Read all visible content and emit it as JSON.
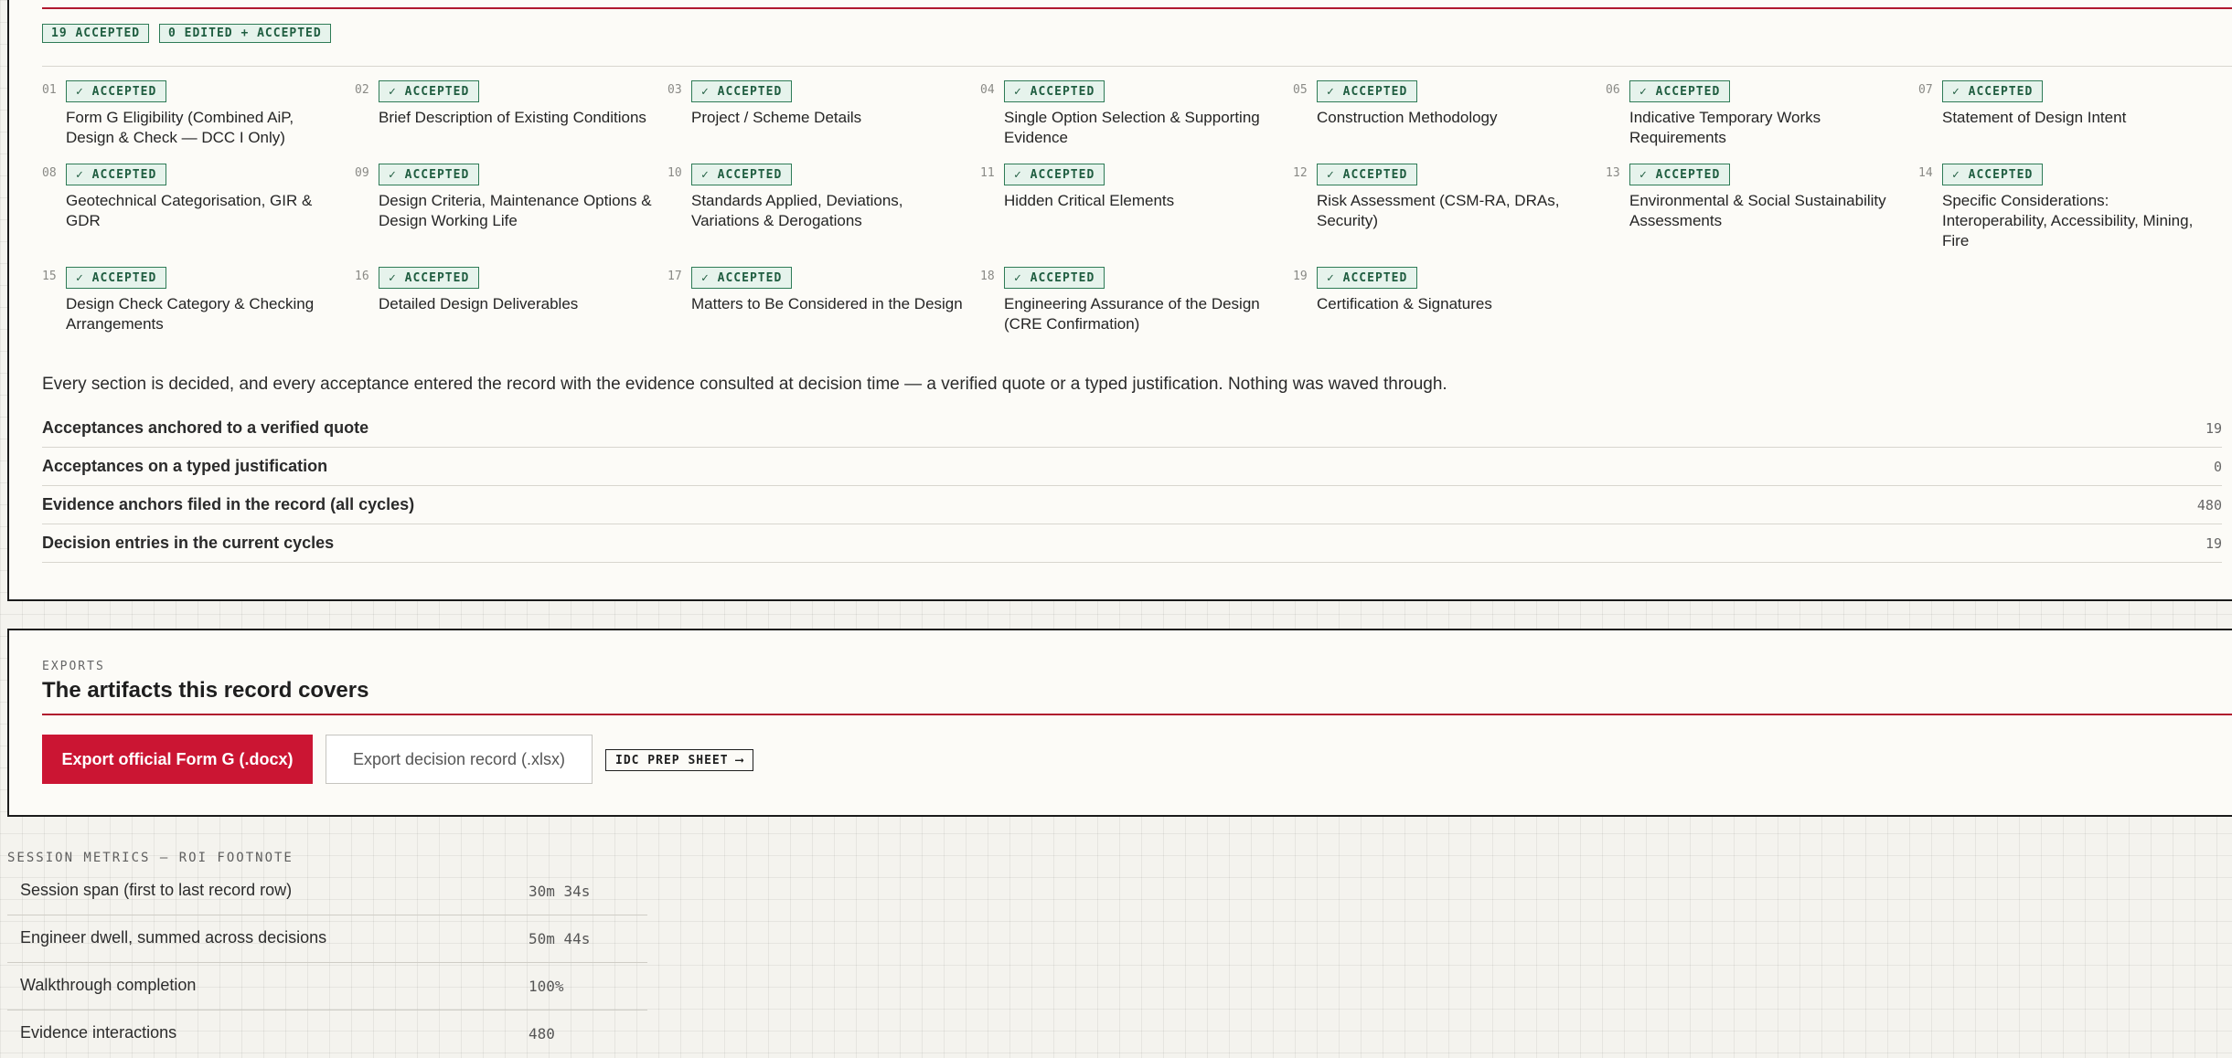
{
  "decisions": {
    "badges": [
      "19 ACCEPTED",
      "0 EDITED + ACCEPTED"
    ],
    "status_label": "✓ ACCEPTED",
    "sections": [
      {
        "num": "01",
        "title": "Form G Eligibility (Combined AiP, Design & Check — DCC I Only)"
      },
      {
        "num": "02",
        "title": "Brief Description of Existing Conditions"
      },
      {
        "num": "03",
        "title": "Project / Scheme Details"
      },
      {
        "num": "04",
        "title": "Single Option Selection & Supporting Evidence"
      },
      {
        "num": "05",
        "title": "Construction Methodology"
      },
      {
        "num": "06",
        "title": "Indicative Temporary Works Requirements"
      },
      {
        "num": "07",
        "title": "Statement of Design Intent"
      },
      {
        "num": "08",
        "title": "Geotechnical Categorisation, GIR & GDR"
      },
      {
        "num": "09",
        "title": "Design Criteria, Maintenance Options & Design Working Life"
      },
      {
        "num": "10",
        "title": "Standards Applied, Deviations, Variations & Derogations"
      },
      {
        "num": "11",
        "title": "Hidden Critical Elements"
      },
      {
        "num": "12",
        "title": "Risk Assessment (CSM-RA, DRAs, Security)"
      },
      {
        "num": "13",
        "title": "Environmental & Social Sustainability Assessments"
      },
      {
        "num": "14",
        "title": "Specific Considerations: Interoperability, Accessibility, Mining, Fire"
      },
      {
        "num": "15",
        "title": "Design Check Category & Checking Arrangements"
      },
      {
        "num": "16",
        "title": "Detailed Design Deliverables"
      },
      {
        "num": "17",
        "title": "Matters to Be Considered in the Design"
      },
      {
        "num": "18",
        "title": "Engineering Assurance of the Design (CRE Confirmation)"
      },
      {
        "num": "19",
        "title": "Certification & Signatures"
      }
    ],
    "summary": "Every section is decided, and every acceptance entered the record with the evidence consulted at decision time — a verified quote or a typed justification. Nothing was waved through.",
    "metrics": [
      {
        "label": "Acceptances anchored to a verified quote",
        "value": "19"
      },
      {
        "label": "Acceptances on a typed justification",
        "value": "0"
      },
      {
        "label": "Evidence anchors filed in the record (all cycles)",
        "value": "480"
      },
      {
        "label": "Decision entries in the current cycles",
        "value": "19"
      }
    ]
  },
  "exports": {
    "eyebrow": "EXPORTS",
    "title": "The artifacts this record covers",
    "primary_button": "Export official Form G (.docx)",
    "secondary_button": "Export decision record (.xlsx)",
    "link_button": "IDC PREP SHEET",
    "link_arrow": "⟶"
  },
  "roi": {
    "eyebrow": "SESSION METRICS — ROI FOOTNOTE",
    "rows": [
      {
        "label": "Session span (first to last record row)",
        "value": "30m 34s"
      },
      {
        "label": "Engineer dwell, summed across decisions",
        "value": "50m 44s"
      },
      {
        "label": "Walkthrough completion",
        "value": "100%"
      },
      {
        "label": "Evidence interactions",
        "value": "480"
      }
    ]
  },
  "colors": {
    "accent_red": "#cb1533",
    "accepted_green": "#2e7b56",
    "accepted_bg": "#e6f3ec"
  }
}
